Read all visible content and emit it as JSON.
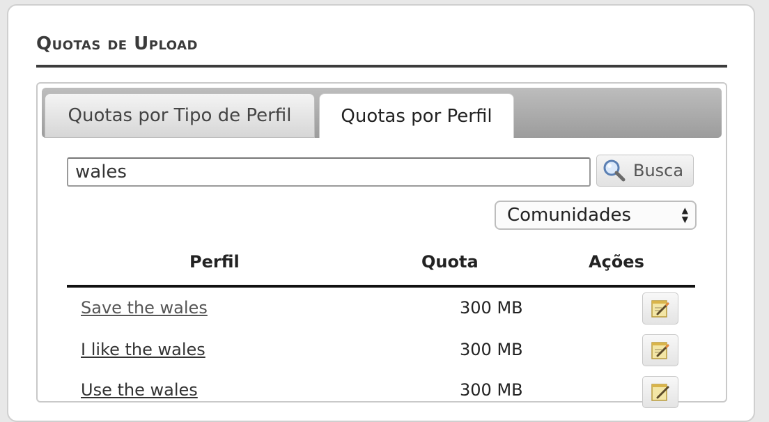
{
  "page": {
    "title": "Quotas de Upload"
  },
  "tabs": [
    {
      "label": "Quotas por Tipo de Perfil",
      "active": false
    },
    {
      "label": "Quotas por Perfil",
      "active": true
    }
  ],
  "search": {
    "value": "wales",
    "button_label": "Busca",
    "icon": "magnifier-icon"
  },
  "filter": {
    "selected": "Comunidades"
  },
  "table": {
    "headers": {
      "profile": "Perfil",
      "quota": "Quota",
      "actions": "Ações"
    },
    "rows": [
      {
        "profile": "Save the wales",
        "quota": "300 MB",
        "action_icon": "edit-icon"
      },
      {
        "profile": "I like the wales",
        "quota": "300 MB",
        "action_icon": "edit-icon"
      },
      {
        "profile": "Use the wales",
        "quota": "300 MB",
        "action_icon": "edit-icon"
      }
    ]
  }
}
